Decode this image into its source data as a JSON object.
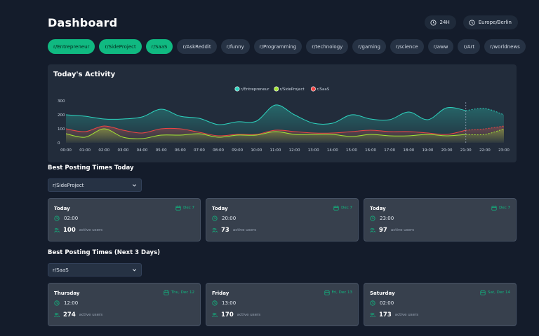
{
  "header": {
    "title": "Dashboard",
    "range_label": "24H",
    "timezone_label": "Europe/Berlin"
  },
  "tabs": [
    {
      "label": "r/Entrepreneur",
      "active": true
    },
    {
      "label": "r/SideProject",
      "active": true
    },
    {
      "label": "r/SaaS",
      "active": true
    },
    {
      "label": "r/AskReddit",
      "active": false
    },
    {
      "label": "r/funny",
      "active": false
    },
    {
      "label": "r/Programming",
      "active": false
    },
    {
      "label": "r/technology",
      "active": false
    },
    {
      "label": "r/gaming",
      "active": false
    },
    {
      "label": "r/science",
      "active": false
    },
    {
      "label": "r/aww",
      "active": false
    },
    {
      "label": "r/Art",
      "active": false
    },
    {
      "label": "r/worldnews",
      "active": false
    }
  ],
  "colors": {
    "accent": "#10b981",
    "entrepreneur": "#2dd4bf",
    "sideproject": "#a3e635",
    "saas": "#ef4444"
  },
  "chart_data": {
    "type": "area",
    "title": "Today's Activity",
    "x": [
      "00:00",
      "01:00",
      "02:00",
      "03:00",
      "04:00",
      "05:00",
      "06:00",
      "07:00",
      "08:00",
      "09:00",
      "10:00",
      "11:00",
      "12:00",
      "13:00",
      "14:00",
      "15:00",
      "16:00",
      "17:00",
      "18:00",
      "19:00",
      "20:00",
      "21:00",
      "22:00",
      "23:00"
    ],
    "yticks": [
      0,
      100,
      200,
      300
    ],
    "ylim": [
      0,
      300
    ],
    "legend_position": "top-center",
    "current_hour_marker": "21:00",
    "series": [
      {
        "name": "r/Entrepreneur",
        "color": "#2dd4bf",
        "values": [
          200,
          190,
          170,
          170,
          185,
          240,
          190,
          175,
          130,
          150,
          155,
          270,
          200,
          140,
          140,
          200,
          170,
          165,
          220,
          165,
          250,
          230,
          245,
          200
        ]
      },
      {
        "name": "r/SideProject",
        "color": "#a3e635",
        "values": [
          65,
          40,
          100,
          40,
          30,
          55,
          55,
          65,
          40,
          55,
          55,
          80,
          60,
          60,
          60,
          45,
          60,
          50,
          50,
          60,
          50,
          60,
          60,
          100
        ]
      },
      {
        "name": "r/SaaS",
        "color": "#ef4444",
        "values": [
          100,
          80,
          120,
          90,
          70,
          100,
          100,
          75,
          50,
          60,
          60,
          90,
          80,
          70,
          70,
          80,
          90,
          80,
          80,
          70,
          60,
          90,
          100,
          120
        ]
      }
    ]
  },
  "best_today": {
    "title": "Best Posting Times Today",
    "selected": "r/SideProject",
    "cards": [
      {
        "day": "Today",
        "date": "Dec 7",
        "time": "02:00",
        "users": "100",
        "users_label": "active users"
      },
      {
        "day": "Today",
        "date": "Dec 7",
        "time": "20:00",
        "users": "73",
        "users_label": "active users"
      },
      {
        "day": "Today",
        "date": "Dec 7",
        "time": "23:00",
        "users": "97",
        "users_label": "active users"
      }
    ]
  },
  "best_next": {
    "title": "Best Posting Times (Next 3 Days)",
    "selected": "r/SaaS",
    "cards": [
      {
        "day": "Thursday",
        "date": "Thu, Dec 12",
        "time": "12:00",
        "users": "274",
        "users_label": "active users"
      },
      {
        "day": "Friday",
        "date": "Fri, Dec 13",
        "time": "13:00",
        "users": "170",
        "users_label": "active users"
      },
      {
        "day": "Saturday",
        "date": "Sat, Dec 14",
        "time": "02:00",
        "users": "173",
        "users_label": "active users"
      }
    ]
  }
}
